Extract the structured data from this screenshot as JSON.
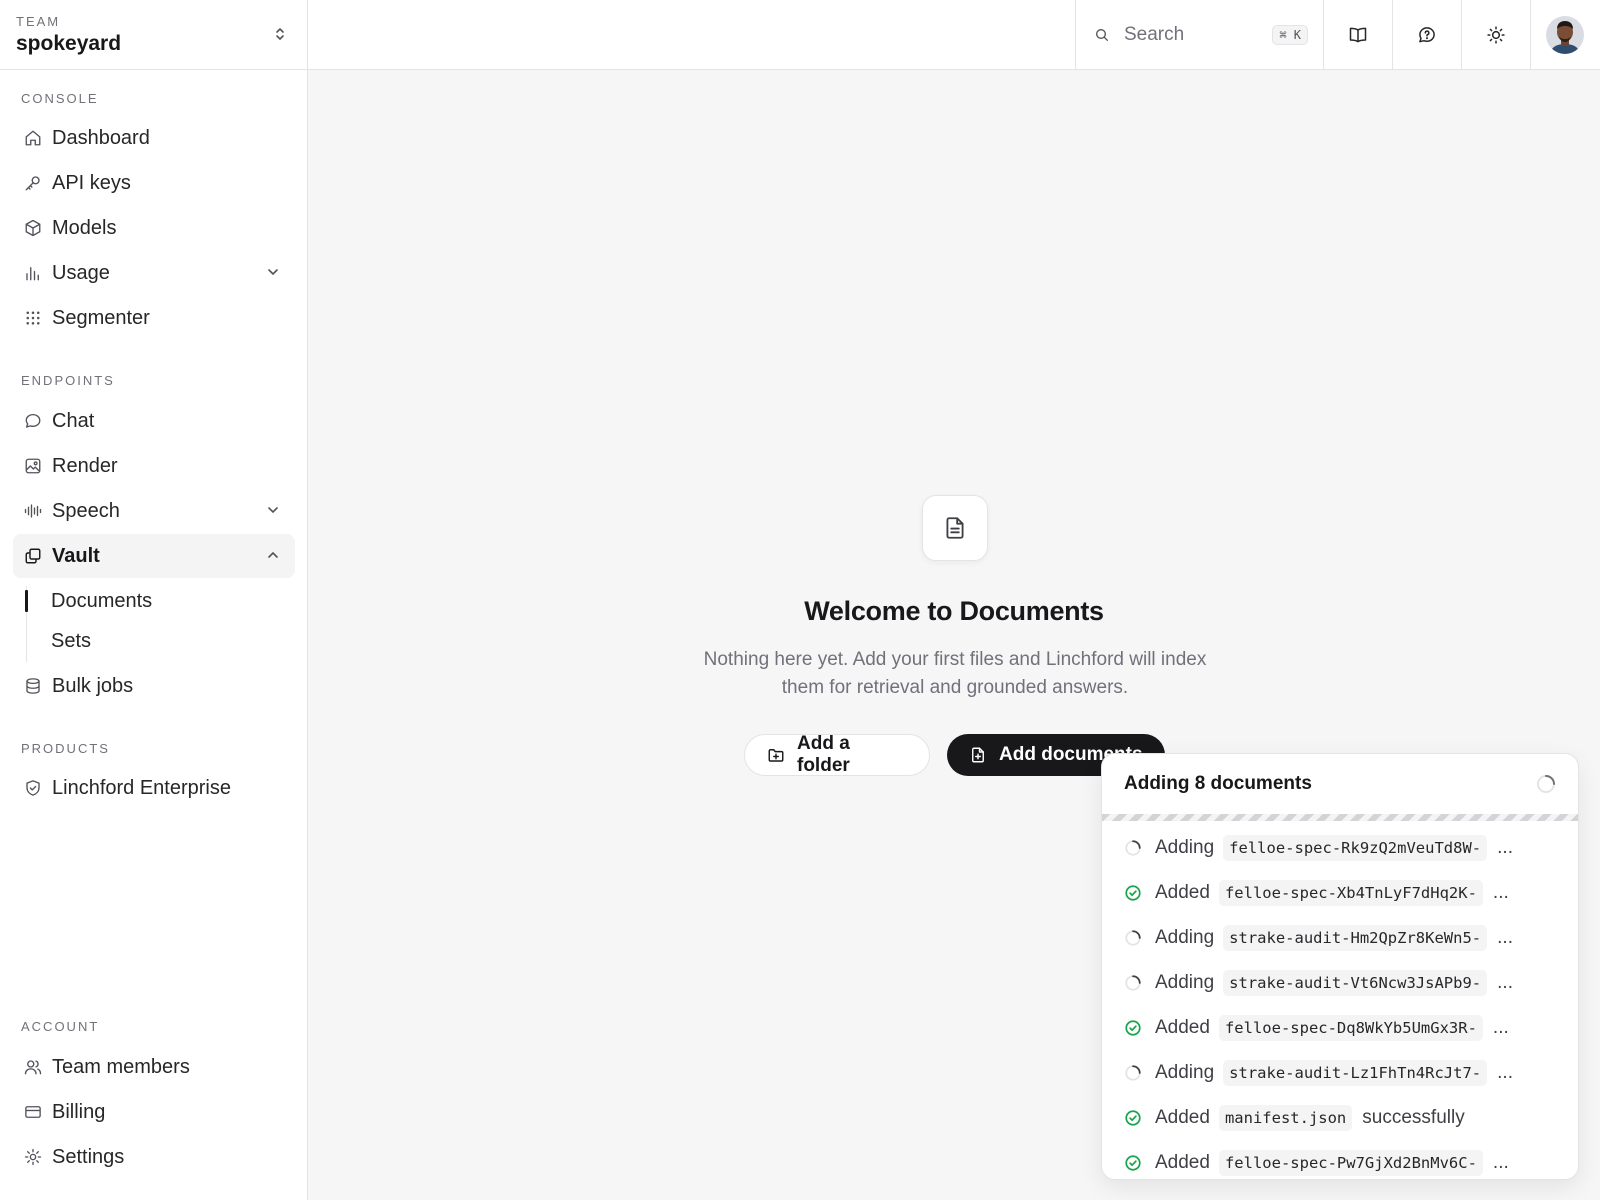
{
  "team": {
    "label": "TEAM",
    "name": "spokeyard"
  },
  "sections": {
    "console": "CONSOLE",
    "endpoints": "ENDPOINTS",
    "products": "PRODUCTS",
    "account": "ACCOUNT"
  },
  "nav": {
    "dashboard": "Dashboard",
    "api_keys": "API keys",
    "models": "Models",
    "usage": "Usage",
    "segmenter": "Segmenter",
    "chat": "Chat",
    "render": "Render",
    "speech": "Speech",
    "vault": "Vault",
    "documents": "Documents",
    "sets": "Sets",
    "bulk_jobs": "Bulk jobs",
    "enterprise": "Linchford Enterprise",
    "team_members": "Team members",
    "billing": "Billing",
    "settings": "Settings"
  },
  "search": {
    "placeholder": "Search",
    "shortcut": "⌘ K"
  },
  "empty_state": {
    "title": "Welcome to Documents",
    "description": "Nothing here yet. Add your first files and Linchford will index them for retrieval and grounded answers.",
    "add_folder": "Add a folder",
    "add_documents": "Add documents"
  },
  "upload_panel": {
    "title": "Adding 8 documents",
    "rows": [
      {
        "status": "Adding",
        "file": "felloe-spec-Rk9zQ2mVeuTd8W-",
        "tail": "..."
      },
      {
        "status": "Added",
        "file": "felloe-spec-Xb4TnLyF7dHq2K-",
        "tail": "..."
      },
      {
        "status": "Adding",
        "file": "strake-audit-Hm2QpZr8KeWn5-",
        "tail": "..."
      },
      {
        "status": "Adding",
        "file": "strake-audit-Vt6Ncw3JsAPb9-",
        "tail": "..."
      },
      {
        "status": "Added",
        "file": "felloe-spec-Dq8WkYb5UmGx3R-",
        "tail": "..."
      },
      {
        "status": "Adding",
        "file": "strake-audit-Lz1FhTn4RcJt7-",
        "tail": "..."
      },
      {
        "status": "Added",
        "file": "manifest.json",
        "tail": "successfully"
      },
      {
        "status": "Added",
        "file": "felloe-spec-Pw7GjXd2BnMv6C-",
        "tail": "..."
      }
    ]
  },
  "colors": {
    "success": "#16a34a",
    "dark": "#18181b",
    "muted": "#71717a"
  }
}
